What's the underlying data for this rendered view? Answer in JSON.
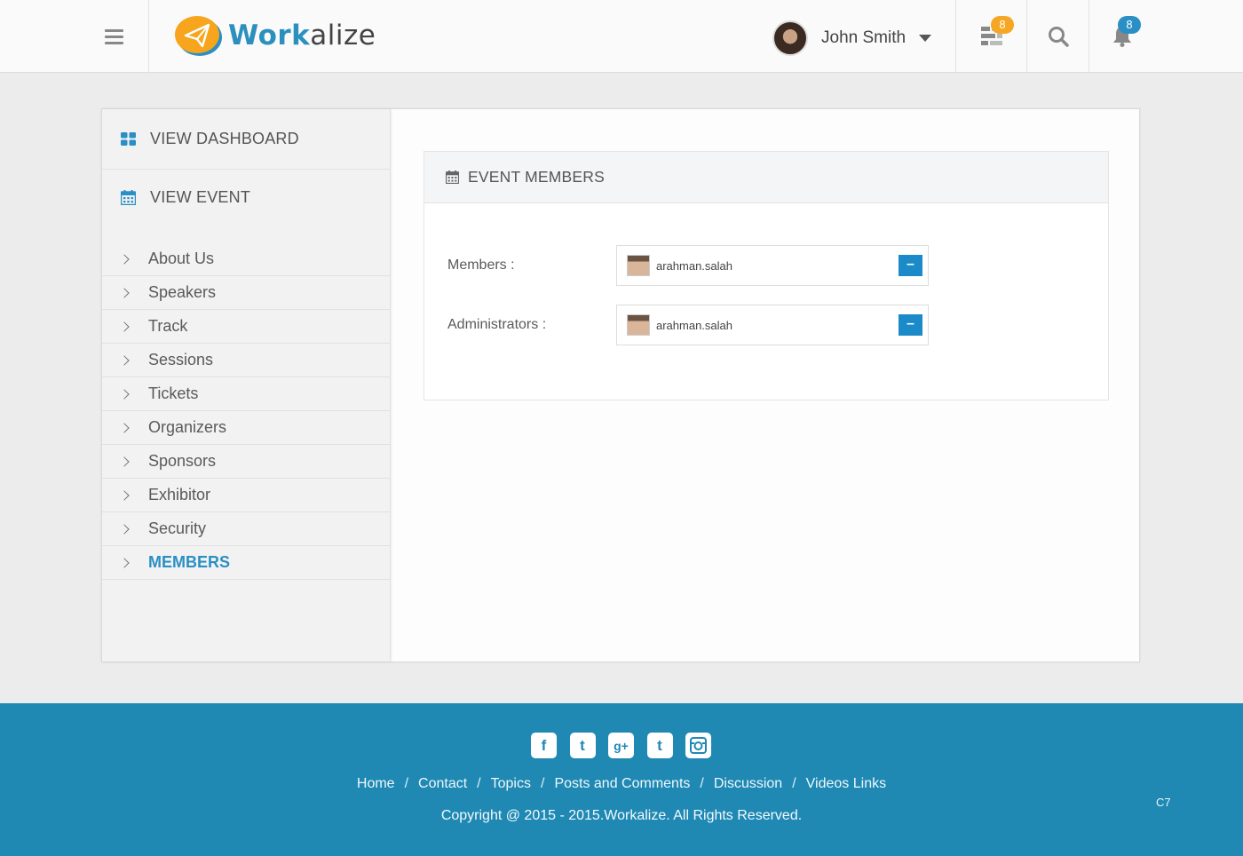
{
  "header": {
    "logo": {
      "part1": "Work",
      "part2": "alize"
    },
    "user": {
      "name": "John Smith"
    },
    "tasks_badge": "8",
    "notifications_badge": "8"
  },
  "sidebar": {
    "top": [
      {
        "label": "VIEW DASHBOARD",
        "icon": "dashboard-grid-icon"
      },
      {
        "label": "VIEW EVENT",
        "icon": "calendar-icon"
      }
    ],
    "items": [
      {
        "label": "About Us"
      },
      {
        "label": "Speakers"
      },
      {
        "label": "Track"
      },
      {
        "label": "Sessions"
      },
      {
        "label": "Tickets"
      },
      {
        "label": "Organizers"
      },
      {
        "label": "Sponsors"
      },
      {
        "label": "Exhibitor"
      },
      {
        "label": "Security"
      },
      {
        "label": "MEMBERS",
        "active": true
      }
    ]
  },
  "card": {
    "title": "EVENT MEMBERS",
    "fields": [
      {
        "label": "Members :",
        "user": "arahman.salah",
        "remove": "–"
      },
      {
        "label": "Administrators :",
        "user": "arahman.salah",
        "remove": "–"
      }
    ]
  },
  "footer": {
    "social": [
      "facebook",
      "twitter",
      "google-plus",
      "tumblr",
      "instagram"
    ],
    "links": [
      "Home",
      "Contact",
      "Topics",
      "Posts and Comments",
      "Discussion",
      "Videos Links"
    ],
    "copyright": "Copyright @ 2015 - 2015.Workalize. All Rights Reserved.",
    "code": "C7"
  },
  "colors": {
    "accent": "#2a8fc4",
    "footer": "#1f89b4",
    "badge_orange": "#f5a623"
  }
}
